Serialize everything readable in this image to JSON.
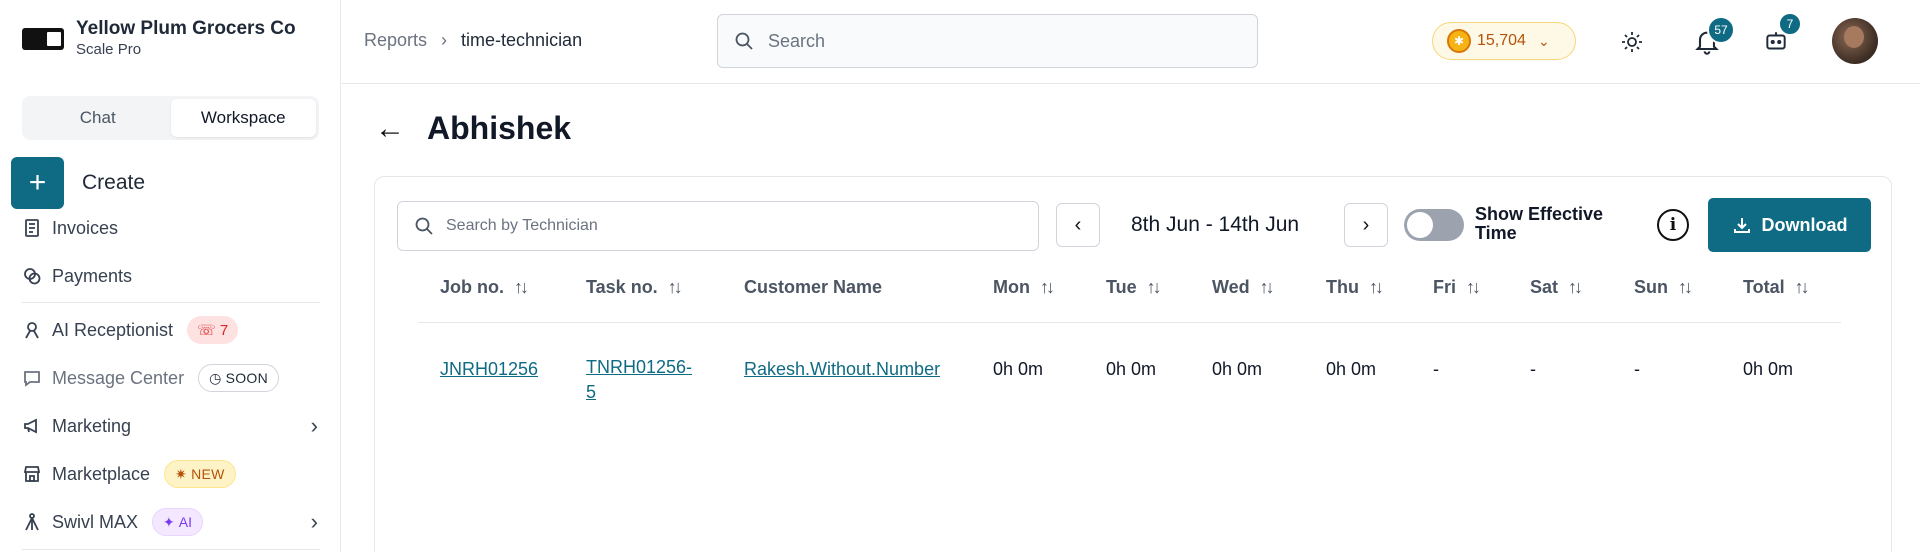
{
  "org": {
    "name": "Yellow Plum Grocers Co",
    "plan": "Scale Pro"
  },
  "sidebar": {
    "tabs": [
      {
        "label": "Chat"
      },
      {
        "label": "Workspace"
      }
    ],
    "create_label": "Create",
    "items": [
      {
        "label": "Invoices",
        "icon": "invoice-icon"
      },
      {
        "label": "Payments",
        "icon": "coins-icon"
      },
      {
        "label": "AI Receptionist",
        "icon": "headset-icon",
        "badge": "7"
      },
      {
        "label": "Message Center",
        "icon": "chat-icon",
        "badge": "SOON"
      },
      {
        "label": "Marketing",
        "icon": "megaphone-icon"
      },
      {
        "label": "Marketplace",
        "icon": "store-icon",
        "badge": "NEW"
      },
      {
        "label": "Swivl MAX",
        "icon": "tripod-icon",
        "badge": "AI"
      }
    ]
  },
  "header": {
    "breadcrumb": [
      "Reports",
      "time-technician"
    ],
    "search_placeholder": "Search",
    "coins": "15,704",
    "notifications_count": "57",
    "messages_count": "7"
  },
  "page": {
    "title": "Abhishek",
    "tech_search_placeholder": "Search by Technician",
    "date_range": "8th Jun - 14th Jun",
    "toggle_label": "Show Effective Time",
    "toggle_on": false,
    "download_label": "Download"
  },
  "table": {
    "columns": [
      "Job no.",
      "Task no.",
      "Customer Name",
      "Mon",
      "Tue",
      "Wed",
      "Thu",
      "Fri",
      "Sat",
      "Sun",
      "Total"
    ],
    "rows": [
      {
        "job_no": "JNRH01256",
        "task_no_line1": "TNRH01256-",
        "task_no_line2": "5",
        "customer": "Rakesh.Without.Number",
        "mon": "0h 0m",
        "tue": "0h 0m",
        "wed": "0h 0m",
        "thu": "0h 0m",
        "fri": "-",
        "sat": "-",
        "sun": "-",
        "total": "0h 0m"
      }
    ]
  },
  "colors": {
    "accent": "#0f6b84",
    "coin_bg": "#fef9e7",
    "badge_red": "#dc2626"
  }
}
